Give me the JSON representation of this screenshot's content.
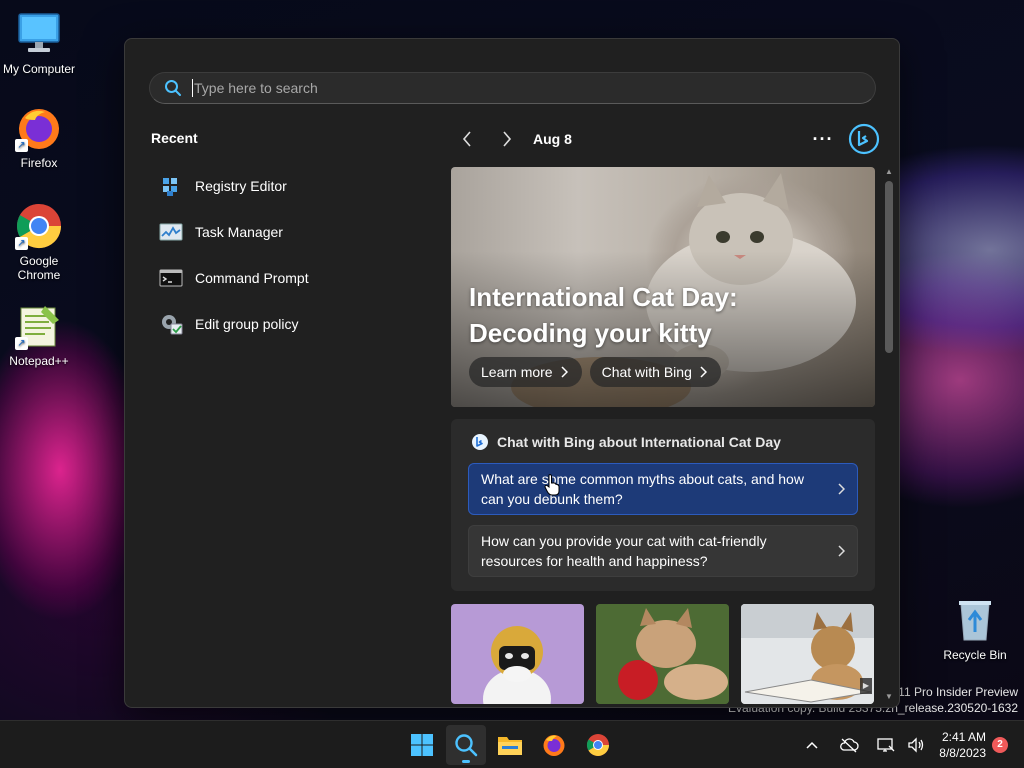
{
  "desktop": {
    "icons": [
      {
        "label": "My Computer",
        "icon": "monitor-icon"
      },
      {
        "label": "Firefox",
        "icon": "firefox-icon"
      },
      {
        "label": "Google Chrome",
        "icon": "chrome-icon"
      },
      {
        "label": "Notepad++",
        "icon": "notepadpp-icon"
      }
    ],
    "recycle_bin": {
      "label": "Recycle Bin",
      "icon": "recycle-bin-icon"
    },
    "watermark": {
      "line1": "s 11 Pro Insider Preview",
      "line2": "Evaluation copy. Build 25375.zn_release.230520-1632"
    }
  },
  "search": {
    "placeholder": "Type here to search",
    "value": ""
  },
  "recent": {
    "title": "Recent",
    "items": [
      {
        "label": "Registry Editor",
        "icon": "registry-editor-icon"
      },
      {
        "label": "Task Manager",
        "icon": "task-manager-icon"
      },
      {
        "label": "Command Prompt",
        "icon": "command-prompt-icon"
      },
      {
        "label": "Edit group policy",
        "icon": "group-policy-icon"
      }
    ]
  },
  "news": {
    "date": "Aug 8",
    "more": "···",
    "hero": {
      "title": "International Cat Day: Decoding your kitty",
      "learn_more": "Learn more",
      "chat_with_bing": "Chat with Bing"
    },
    "chat_card": {
      "heading": "Chat with Bing about International Cat Day",
      "prompts": [
        "What are some common myths about cats, and how can you debunk them?",
        "How can you provide your cat with cat-friendly resources for health and happiness?"
      ]
    }
  },
  "taskbar": {
    "apps": [
      "windows-start-icon",
      "search-icon",
      "file-explorer-icon",
      "firefox-icon",
      "chrome-icon"
    ],
    "time": "2:41 AM",
    "date": "8/8/2023",
    "notifications": "2"
  },
  "colors": {
    "accent": "#4cc2ff",
    "panel_bg": "#202020",
    "active_prompt": "#1d3a78",
    "badge": "#f05a5a"
  }
}
